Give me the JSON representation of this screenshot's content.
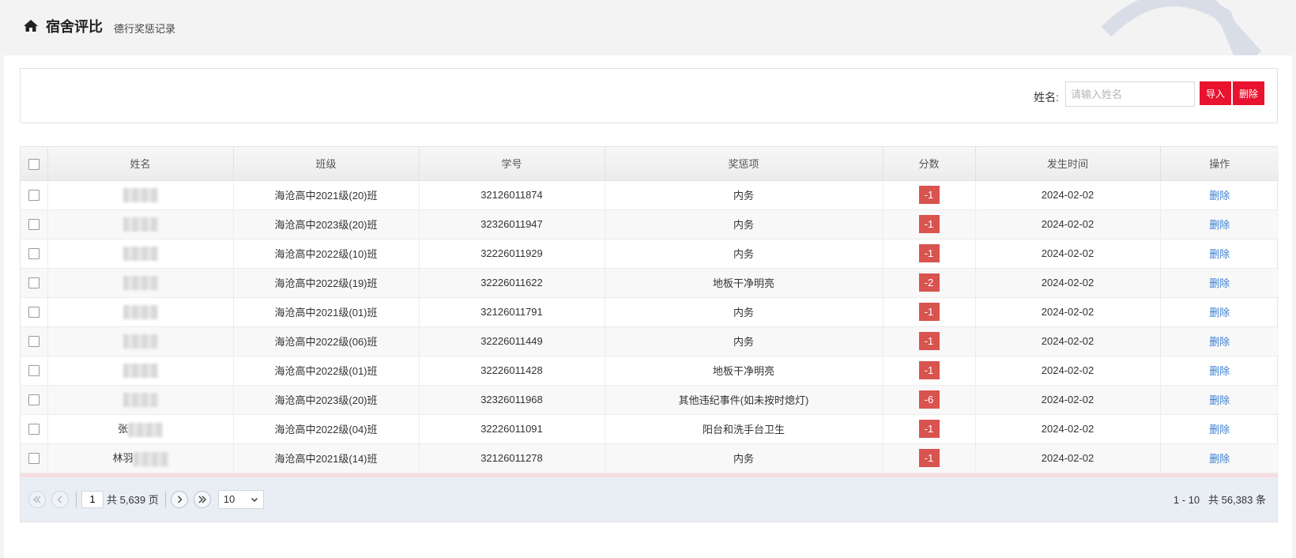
{
  "header": {
    "title": "宿舍评比",
    "subtitle": "德行奖惩记录"
  },
  "search": {
    "label": "姓名:",
    "placeholder": "请输入姓名",
    "import_label": "导入",
    "delete_label": "删除"
  },
  "table": {
    "columns": [
      "姓名",
      "班级",
      "学号",
      "奖惩项",
      "分数",
      "发生时间",
      "操作"
    ],
    "rows": [
      {
        "name_visible": "",
        "class": "海沧高中2021级(20)班",
        "id": "32126011874",
        "item": "内务",
        "score": "-1",
        "date": "2024-02-02",
        "action": "删除"
      },
      {
        "name_visible": "",
        "class": "海沧高中2023级(20)班",
        "id": "32326011947",
        "item": "内务",
        "score": "-1",
        "date": "2024-02-02",
        "action": "删除"
      },
      {
        "name_visible": "",
        "class": "海沧高中2022级(10)班",
        "id": "32226011929",
        "item": "内务",
        "score": "-1",
        "date": "2024-02-02",
        "action": "删除"
      },
      {
        "name_visible": "",
        "class": "海沧高中2022级(19)班",
        "id": "32226011622",
        "item": "地板干净明亮",
        "score": "-2",
        "date": "2024-02-02",
        "action": "删除"
      },
      {
        "name_visible": "",
        "class": "海沧高中2021级(01)班",
        "id": "32126011791",
        "item": "内务",
        "score": "-1",
        "date": "2024-02-02",
        "action": "删除"
      },
      {
        "name_visible": "",
        "class": "海沧高中2022级(06)班",
        "id": "32226011449",
        "item": "内务",
        "score": "-1",
        "date": "2024-02-02",
        "action": "删除"
      },
      {
        "name_visible": "",
        "class": "海沧高中2022级(01)班",
        "id": "32226011428",
        "item": "地板干净明亮",
        "score": "-1",
        "date": "2024-02-02",
        "action": "删除"
      },
      {
        "name_visible": "",
        "class": "海沧高中2023级(20)班",
        "id": "32326011968",
        "item": "其他违纪事件(如未按时熄灯)",
        "score": "-6",
        "date": "2024-02-02",
        "action": "删除"
      },
      {
        "name_visible": "张",
        "class": "海沧高中2022级(04)班",
        "id": "32226011091",
        "item": "阳台和洗手台卫生",
        "score": "-1",
        "date": "2024-02-02",
        "action": "删除"
      },
      {
        "name_visible": "林羽",
        "class": "海沧高中2021级(14)班",
        "id": "32126011278",
        "item": "内务",
        "score": "-1",
        "date": "2024-02-02",
        "action": "删除"
      }
    ]
  },
  "pager": {
    "current_page": "1",
    "total_pages_text": "共 5,639 页",
    "page_size": "10",
    "range_text": "1 - 10",
    "total_text": "共 56,383 条"
  },
  "colors": {
    "accent_red": "#e8132f",
    "score_red": "#d9534f",
    "link_blue": "#3a7fd0"
  }
}
